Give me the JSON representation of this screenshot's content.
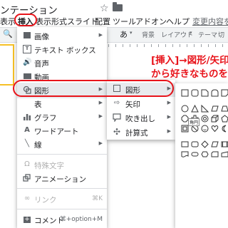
{
  "window": {
    "title": "ンテーション",
    "star_icon": "star-icon",
    "folder_icon": "folder-icon"
  },
  "menubar": {
    "items": [
      "表示",
      "挿入",
      "表示形式",
      "スライド",
      "配置",
      "ツール",
      "アドオン",
      "ヘルプ"
    ],
    "last_edit": "変更内容をす"
  },
  "toolbar": {
    "font_sample": "あ",
    "background": "背景",
    "layout": "レイアウト",
    "theme": "テーマ",
    "transition": "切"
  },
  "annotation": {
    "line1": "[挿入]→図形/矢印",
    "line2": "から好きなものを"
  },
  "insert_menu": {
    "items": [
      {
        "label": "画像",
        "icon": "image-icon",
        "submenu": true
      },
      {
        "label": "テキスト ボックス",
        "icon": "textbox-icon",
        "submenu": false
      },
      {
        "label": "音声",
        "icon": "audio-icon",
        "submenu": false
      },
      {
        "label": "動画",
        "icon": "video-icon",
        "submenu": false
      },
      {
        "label": "図形",
        "icon": "shape-icon",
        "submenu": true
      },
      {
        "label": "表",
        "icon": "",
        "submenu": true
      },
      {
        "label": "グラフ",
        "icon": "chart-icon",
        "submenu": true
      },
      {
        "label": "ワードアート",
        "icon": "wordart-icon",
        "submenu": false
      },
      {
        "label": "線",
        "icon": "line-icon",
        "submenu": true
      },
      {
        "label": "特殊文字",
        "icon": "omega-icon",
        "submenu": false
      },
      {
        "label": "アニメーション",
        "icon": "animation-icon",
        "submenu": false
      },
      {
        "label": "リンク",
        "icon": "link-icon",
        "shortcut": "⌘K"
      },
      {
        "label": "コメント",
        "icon": "comment-icon",
        "shortcut": "⌘+option+M"
      }
    ]
  },
  "shape_submenu": {
    "items": [
      {
        "label": "図形",
        "icon": "square-icon"
      },
      {
        "label": "矢印",
        "icon": "arrow-icon"
      },
      {
        "label": "吹き出し",
        "icon": "callout-icon"
      },
      {
        "label": "計算式",
        "icon": "plus-icon"
      }
    ]
  },
  "tooltip": "角円",
  "colors": {
    "highlight": "#e8141b",
    "menu_hover": "#e8eaed",
    "slide_border": "#f6c026"
  }
}
